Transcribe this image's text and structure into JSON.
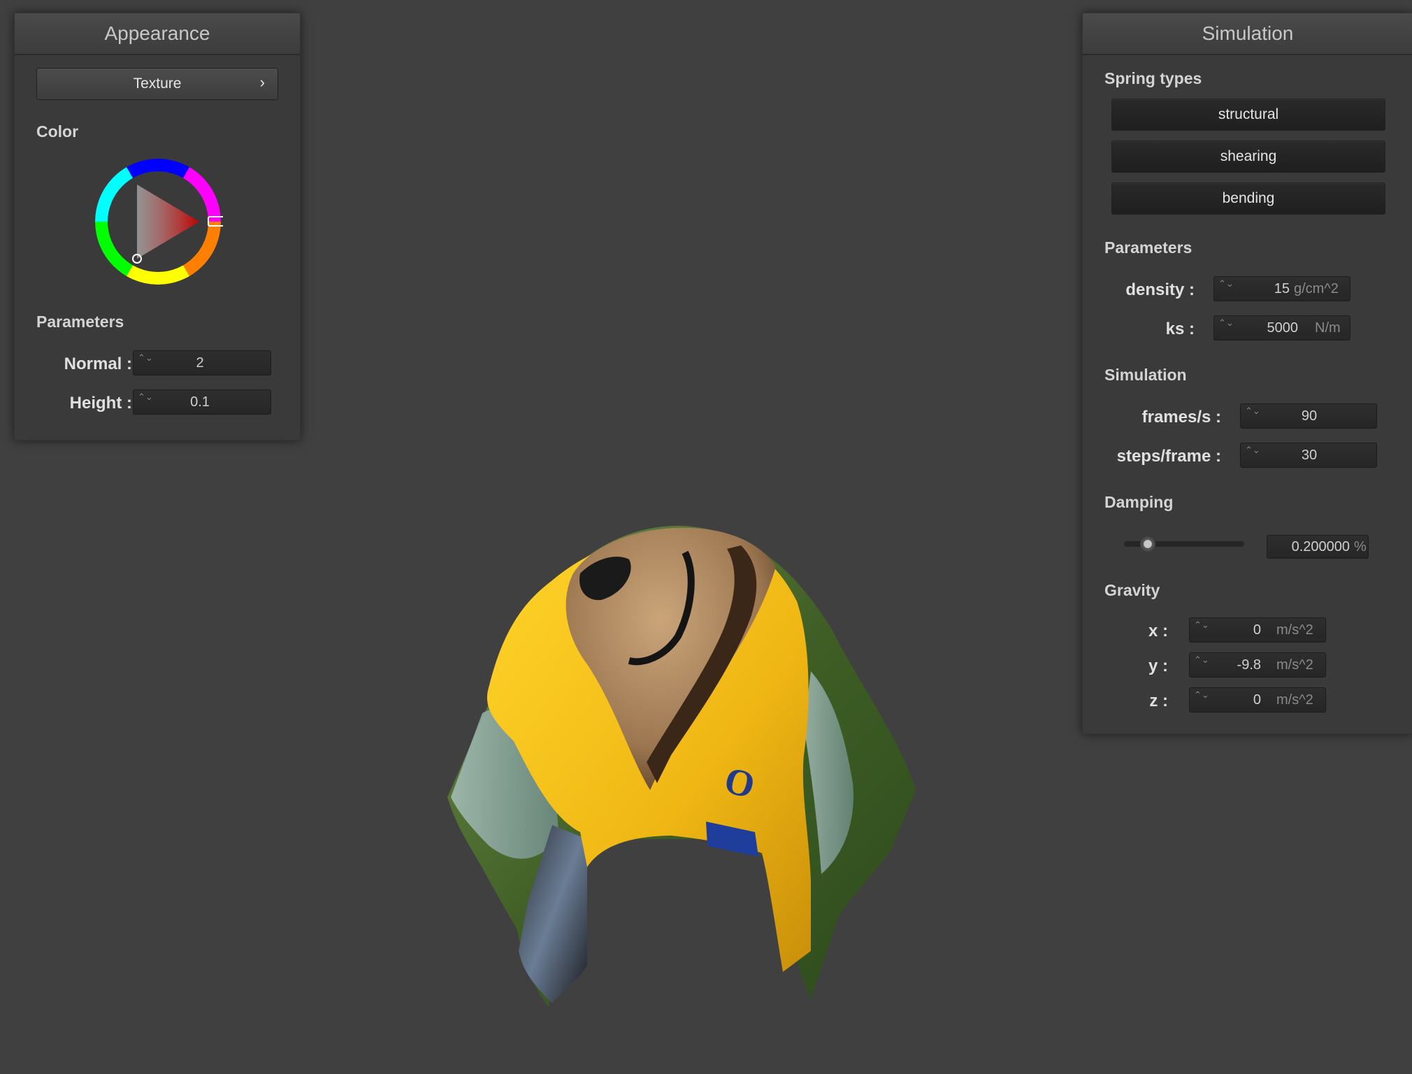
{
  "appearance": {
    "title": "Appearance",
    "texture_button": "Texture",
    "chevron": "›",
    "color_label": "Color",
    "color_wheel": {
      "icon": "color-wheel-icon",
      "selected_hue": "#ff0000"
    },
    "parameters_label": "Parameters",
    "normal_label": "Normal :",
    "normal_value": "2",
    "height_label": "Height :",
    "height_value": "0.1"
  },
  "simulation": {
    "title": "Simulation",
    "spring_types_label": "Spring types",
    "spring_buttons": [
      "structural",
      "shearing",
      "bending"
    ],
    "parameters_label": "Parameters",
    "density_label": "density :",
    "density_value": "15",
    "density_unit": "g/cm^2",
    "ks_label": "ks :",
    "ks_value": "5000",
    "ks_unit": "N/m",
    "simulation_label": "Simulation",
    "fps_label": "frames/s :",
    "fps_value": "90",
    "steps_label": "steps/frame :",
    "steps_value": "30",
    "damping_label": "Damping",
    "damping_value": "0.200000",
    "damping_unit": "%",
    "damping_level": 0.2,
    "gravity_label": "Gravity",
    "gx_label": "x :",
    "gx_value": "0",
    "gy_label": "y :",
    "gy_value": "-9.8",
    "gz_label": "z :",
    "gz_value": "0",
    "gravity_unit": "m/s^2"
  },
  "spin_arrows": "⌃⌄",
  "colors": {
    "background": "#404040",
    "panel": "#3a3a3a",
    "cloth_yellow": "#f2c21a",
    "cloth_green": "#4a6a2c"
  }
}
